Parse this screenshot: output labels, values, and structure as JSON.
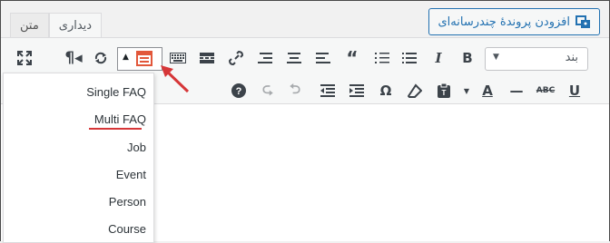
{
  "header": {
    "add_media_label": "افزودن پروندهٔ چندرسانه‌ای",
    "tabs": [
      {
        "label": "دیداری",
        "active": true
      },
      {
        "label": "متن",
        "active": false
      }
    ]
  },
  "toolbar": {
    "format_select": {
      "value": "بند"
    },
    "icons_row1": [
      "paragraph-format-select",
      "bold-icon",
      "italic-icon",
      "bullet-list-icon",
      "numbered-list-icon",
      "blockquote-icon",
      "align-left-icon",
      "align-center-icon",
      "align-right-icon",
      "link-icon",
      "read-more-icon",
      "toolbar-toggle-icon",
      "faq-shortcode-dropdown-icon",
      "refresh-icon",
      "paragraph-mark-icon",
      "fullscreen-icon"
    ],
    "icons_row2": [
      "underline-icon",
      "strikethrough-icon",
      "horizontal-line-icon",
      "text-color-icon",
      "paste-text-icon",
      "clear-formatting-icon",
      "special-character-icon",
      "indent-icon",
      "outdent-icon",
      "undo-icon",
      "redo-icon",
      "help-icon"
    ]
  },
  "dropdown_menu": {
    "items": [
      "Single FAQ",
      "Multi FAQ",
      "Job",
      "Event",
      "Person",
      "Course"
    ],
    "highlighted": "Multi FAQ"
  },
  "colors": {
    "accent": "#2271b1",
    "annotation_red": "#d63638",
    "dropdown_icon": "#e2573a"
  }
}
